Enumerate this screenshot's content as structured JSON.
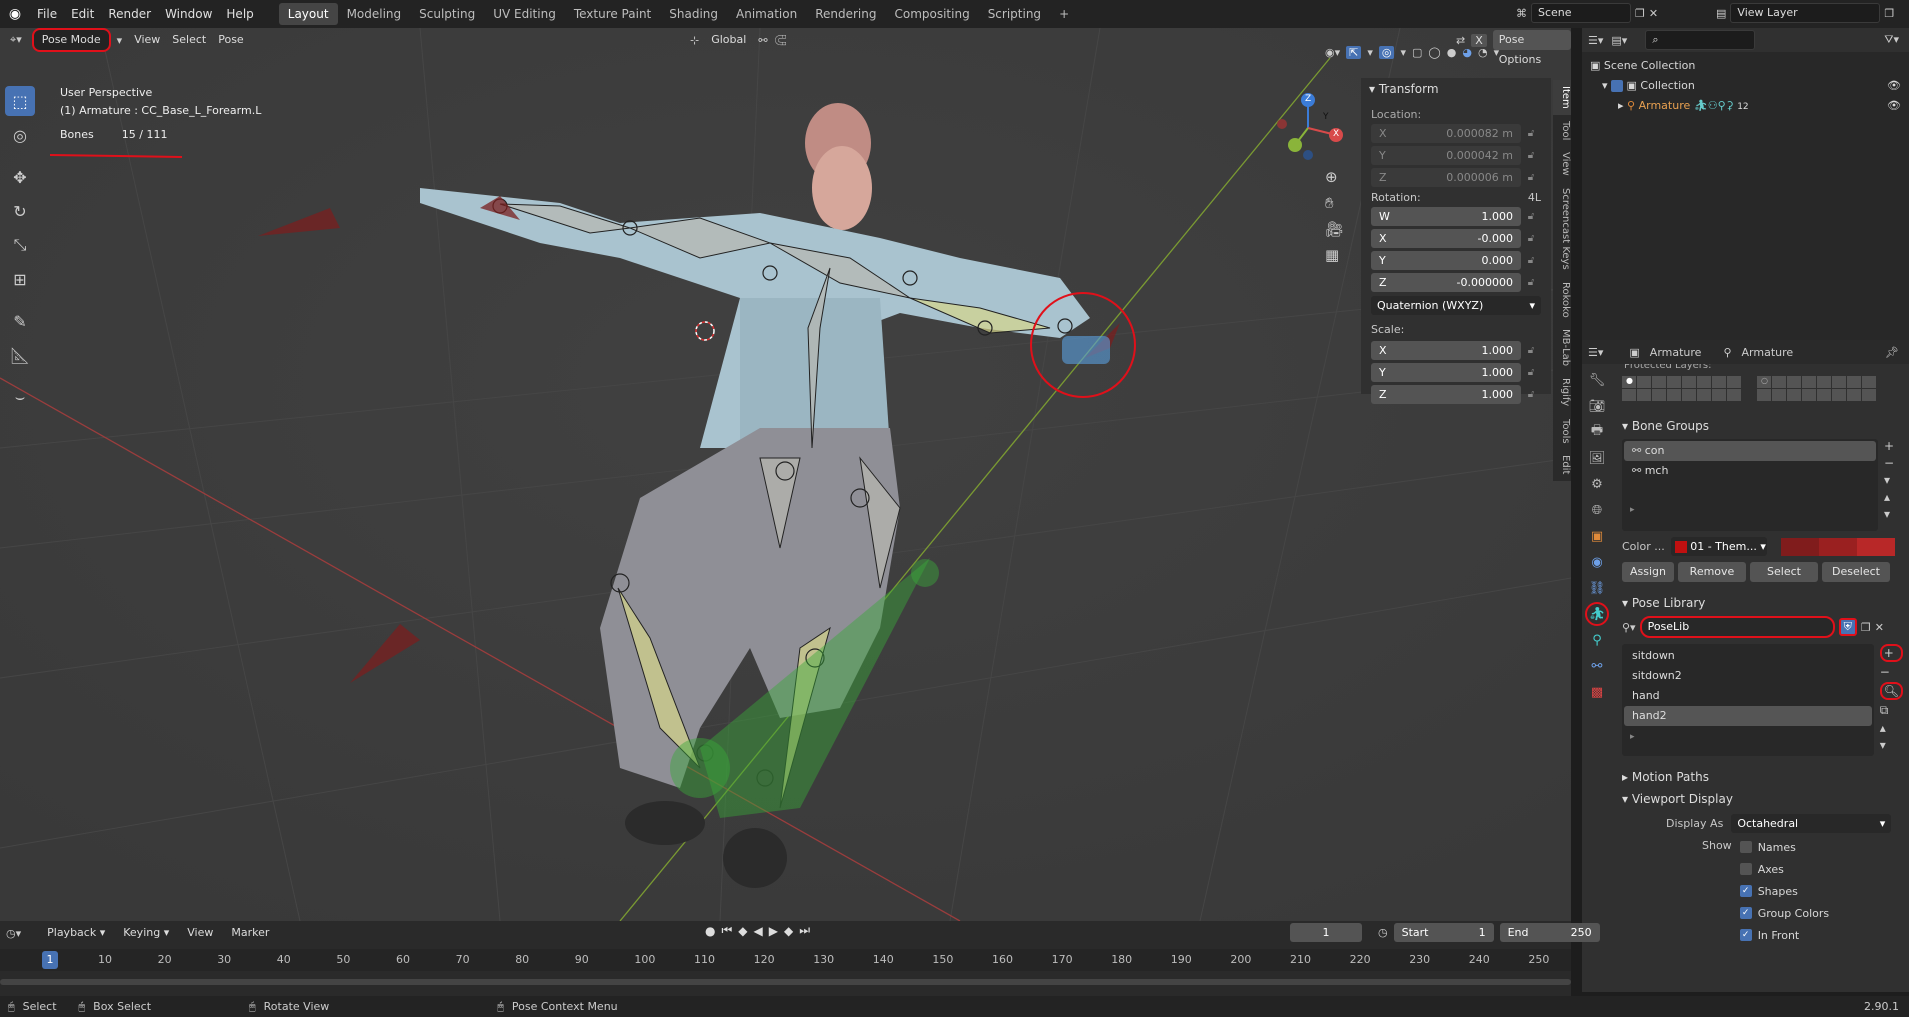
{
  "topbar": {
    "menus": [
      "File",
      "Edit",
      "Render",
      "Window",
      "Help"
    ],
    "workspaces": [
      "Layout",
      "Modeling",
      "Sculpting",
      "UV Editing",
      "Texture Paint",
      "Shading",
      "Animation",
      "Rendering",
      "Compositing",
      "Scripting"
    ],
    "active_workspace": "Layout",
    "add_tab": "+",
    "scene": "Scene",
    "view_layer": "View Layer"
  },
  "viewport_header": {
    "mode": "Pose Mode",
    "menus": [
      "View",
      "Select",
      "Pose"
    ],
    "orientation": "Global",
    "pose_options": "Pose Options",
    "x_label": "X"
  },
  "overlay": {
    "perspective": "User Perspective",
    "object": "(1) Armature : CC_Base_L_Forearm.L",
    "bones_label": "Bones",
    "bones_count": "15 / 111"
  },
  "gizmo": {
    "z": "Z",
    "y": "Y",
    "x": "X"
  },
  "npanel": {
    "title": "Transform",
    "location_label": "Location:",
    "location": [
      {
        "axis": "X",
        "value": "0.000082 m"
      },
      {
        "axis": "Y",
        "value": "0.000042 m"
      },
      {
        "axis": "Z",
        "value": "0.000006 m"
      }
    ],
    "rotation_label": "Rotation:",
    "rotation_mode_short": "4L",
    "rotation": [
      {
        "axis": "W",
        "value": "1.000"
      },
      {
        "axis": "X",
        "value": "-0.000"
      },
      {
        "axis": "Y",
        "value": "0.000"
      },
      {
        "axis": "Z",
        "value": "-0.000000"
      }
    ],
    "rotation_mode": "Quaternion (WXYZ)",
    "scale_label": "Scale:",
    "scale": [
      {
        "axis": "X",
        "value": "1.000"
      },
      {
        "axis": "Y",
        "value": "1.000"
      },
      {
        "axis": "Z",
        "value": "1.000"
      }
    ],
    "tabs": [
      "Item",
      "Tool",
      "View",
      "Screencast Keys",
      "Rokoko",
      "MB-Lab",
      "Rigify",
      "Tools",
      "Edit"
    ]
  },
  "outliner": {
    "root": "Scene Collection",
    "collection": "Collection",
    "armature": "Armature",
    "badge": "12"
  },
  "properties": {
    "header_object": "Armature",
    "header_data": "Armature",
    "protected_layers": "Protected Layers:",
    "bone_groups_title": "Bone Groups",
    "bone_groups": [
      "con",
      "mch"
    ],
    "color_label": "Color ...",
    "color_set": "01 - Them...",
    "assign": "Assign",
    "remove": "Remove",
    "select": "Select",
    "deselect": "Deselect",
    "pose_library_title": "Pose Library",
    "poselib_name": "PoseLib",
    "poses": [
      "sitdown",
      "sitdown2",
      "hand",
      "hand2"
    ],
    "motion_paths": "Motion Paths",
    "viewport_display": "Viewport Display",
    "display_as_label": "Display As",
    "display_as": "Octahedral",
    "show_label": "Show",
    "show_items": [
      {
        "label": "Names",
        "checked": false
      },
      {
        "label": "Axes",
        "checked": false
      },
      {
        "label": "Shapes",
        "checked": true
      },
      {
        "label": "Group Colors",
        "checked": true
      },
      {
        "label": "In Front",
        "checked": true
      }
    ]
  },
  "timeline": {
    "menus": [
      "Playback",
      "Keying",
      "View",
      "Marker"
    ],
    "current_frame": "1",
    "start_label": "Start",
    "start": "1",
    "end_label": "End",
    "end": "250",
    "ticks": [
      "10",
      "20",
      "30",
      "40",
      "50",
      "60",
      "70",
      "80",
      "90",
      "100",
      "110",
      "120",
      "130",
      "140",
      "150",
      "160",
      "170",
      "180",
      "190",
      "200",
      "210",
      "220",
      "230",
      "240",
      "250"
    ],
    "playhead": "1"
  },
  "statusbar": {
    "select": "Select",
    "box_select": "Box Select",
    "rotate_view": "Rotate View",
    "context_menu": "Pose Context Menu",
    "version": "2.90.1"
  }
}
